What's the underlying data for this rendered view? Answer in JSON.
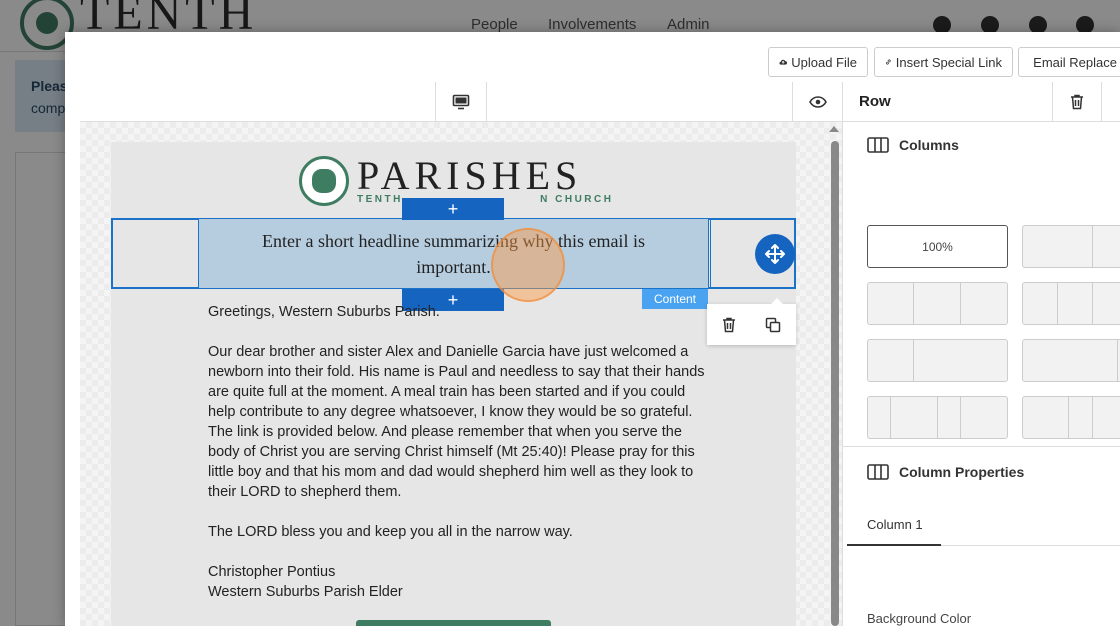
{
  "background_app": {
    "brand": "TENTH",
    "nav": [
      "People",
      "Involvements",
      "Admin"
    ],
    "panel_text_1": "Pleas",
    "panel_text_2": "comp"
  },
  "toolbar": {
    "upload_label": "Upload File",
    "insert_link_label": "Insert Special Link",
    "email_replace_label": "Email Replace"
  },
  "email": {
    "brand": "PARISHES",
    "brand_sub_left": "TENTH",
    "brand_sub_right": "N CHURCH",
    "headline": "Enter a short headline summarizing why this email is important.",
    "content_tag": "Content",
    "add_symbol": "+",
    "greeting": "Greetings, Western Suburbs Parish.",
    "paragraph": "Our dear brother and sister Alex and Danielle Garcia have just welcomed a newborn into their fold. His name is Paul and needless to say that their hands are quite full at the moment. A meal train has been started and if you could help contribute to any degree whatsoever, I know they would be so grateful. The link is provided below. And please remember that when you serve the body of Christ you are serving Christ himself (Mt 25:40)! Please pray for this little boy and that his mom and dad would shepherd him well as they look to their LORD to shepherd them.",
    "blessing": "The LORD bless you and keep you all in the narrow way.",
    "signature_name": "Christopher Pontius",
    "signature_title": "Western Suburbs Parish Elder"
  },
  "side_panel": {
    "title": "Row",
    "columns_heading": "Columns",
    "col_active_label": "100%",
    "col_props_heading": "Column Properties",
    "tab_label": "Column 1",
    "bg_color_label": "Background Color"
  },
  "colors": {
    "accent_blue": "#1565c0",
    "brand_green": "#3f7d62",
    "selection_fill": "#b6cde0"
  }
}
